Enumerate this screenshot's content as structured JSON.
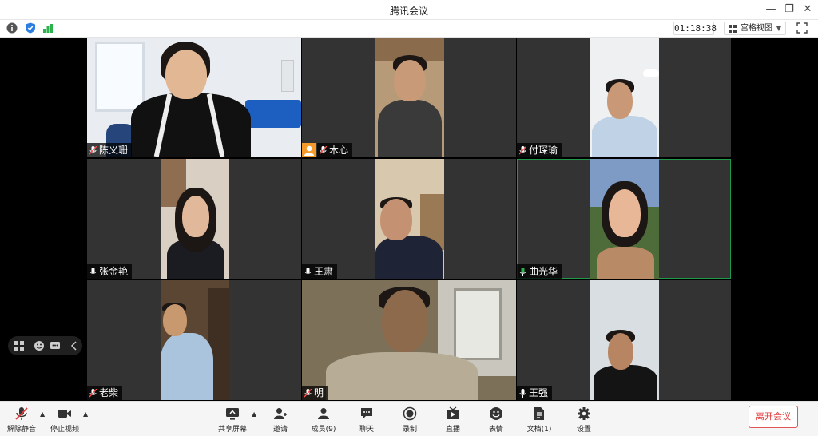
{
  "window": {
    "title": "腾讯会议"
  },
  "status_bar": {
    "timer": "01:18:38",
    "view_label": "宫格视图",
    "colors": {
      "info": "#555555",
      "shield": "#2a7de1",
      "signal": "#2bb24c"
    }
  },
  "participants": [
    {
      "name": "陈义珊",
      "mic": "muted"
    },
    {
      "name": "木心",
      "mic": "muted",
      "avatar_badge": true
    },
    {
      "name": "付琛瑜",
      "mic": "muted"
    },
    {
      "name": "张金艳",
      "mic": "on"
    },
    {
      "name": "王肃",
      "mic": "on"
    },
    {
      "name": "曲光华",
      "mic": "speaking",
      "active": true
    },
    {
      "name": "老柴",
      "mic": "muted"
    },
    {
      "name": "明",
      "mic": "muted"
    },
    {
      "name": "王强",
      "mic": "on"
    }
  ],
  "toolbar": {
    "unmute": "解除静音",
    "stop_video": "停止视频",
    "share_screen": "共享屏幕",
    "invite": "邀请",
    "members": "成员(9)",
    "chat": "聊天",
    "record": "录制",
    "live": "直播",
    "reactions": "表情",
    "docs": "文档(1)",
    "settings": "设置",
    "leave": "离开会议"
  },
  "accent_colors": {
    "leave": "#e03c3c",
    "active_border": "#1f9a4a",
    "speaking_mic": "#2bb24c"
  }
}
